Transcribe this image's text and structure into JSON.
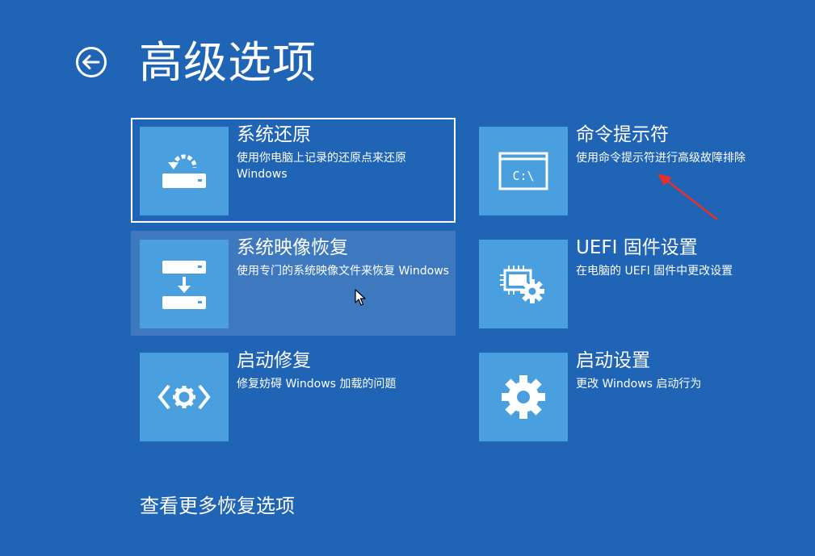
{
  "page": {
    "title": "高级选项",
    "back_label": "back"
  },
  "tiles": [
    {
      "title": "系统还原",
      "desc": "使用你电脑上记录的还原点来还原 Windows",
      "icon": "system-restore-icon"
    },
    {
      "title": "系统映像恢复",
      "desc": "使用专门的系统映像文件来恢复 Windows",
      "icon": "system-image-recovery-icon"
    },
    {
      "title": "启动修复",
      "desc": "修复妨碍 Windows 加载的问题",
      "icon": "startup-repair-icon"
    },
    {
      "title": "命令提示符",
      "desc": "使用命令提示符进行高级故障排除",
      "icon": "command-prompt-icon",
      "icon_text": "C:\\"
    },
    {
      "title": "UEFI 固件设置",
      "desc": "在电脑的 UEFI 固件中更改设置",
      "icon": "uefi-firmware-icon"
    },
    {
      "title": "启动设置",
      "desc": "更改 Windows 启动行为",
      "icon": "gear-icon"
    }
  ],
  "footer": {
    "more_options": "查看更多恢复选项"
  },
  "colors": {
    "background": "#1f64b5",
    "tile_icon_bg": "#4aa0de",
    "text": "#ffffff",
    "annotation_arrow": "#e8302a"
  },
  "state": {
    "selected_tile": "系统还原",
    "hovered_tile": "系统映像恢复"
  }
}
